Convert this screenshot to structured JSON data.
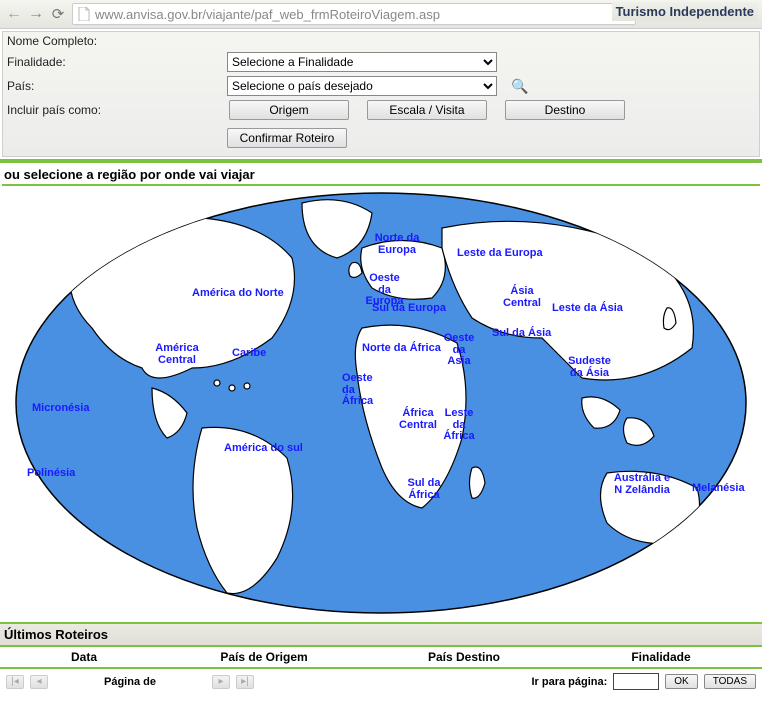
{
  "browser": {
    "url": "www.anvisa.gov.br/viajante/paf_web_frmRoteiroViagem.asp",
    "brand": "Turismo Independente"
  },
  "form": {
    "nome_label": "Nome Completo:",
    "finalidade_label": "Finalidade:",
    "finalidade_selected": "Selecione a Finalidade",
    "pais_label": "País:",
    "pais_selected": "Selecione o país desejado",
    "incluir_label": "Incluir país como:",
    "btn_origem": "Origem",
    "btn_escala": "Escala / Visita",
    "btn_destino": "Destino",
    "btn_confirmar": "Confirmar Roteiro"
  },
  "map_section": {
    "title": "ou selecione a região por onde vai viajar",
    "regions": {
      "america_norte": "América do Norte",
      "america_central": "América Central",
      "caribe": "Caribe",
      "america_sul": "América do sul",
      "micronesia": "Micronésia",
      "polinesia": "Polinésia",
      "norte_europa": "Norte da Europa",
      "oeste_europa": "Oeste da Europa",
      "sul_europa": "Sul da Europa",
      "leste_europa": "Leste da Europa",
      "norte_africa": "Norte da África",
      "oeste_africa": "Oeste da África",
      "africa_central": "África Central",
      "leste_africa": "Leste da África",
      "sul_africa": "Sul da África",
      "oeste_asia": "Oeste da Asia",
      "asia_central": "Ásia Central",
      "sul_asia": "Sul da Ásia",
      "leste_asia": "Leste da  Ásia",
      "sudeste_asia": "Sudeste da Ásia",
      "australia": "Austrália e N Zelândia",
      "melanesia": "Melanésia"
    }
  },
  "footer": {
    "title": "Últimos Roteiros",
    "col_data": "Data",
    "col_origem": "País de Origem",
    "col_destino": "País Destino",
    "col_finalidade": "Finalidade",
    "pagina_de": "Página de",
    "ir_para": "Ir para página:",
    "ok": "OK",
    "todas": "TODAS"
  }
}
